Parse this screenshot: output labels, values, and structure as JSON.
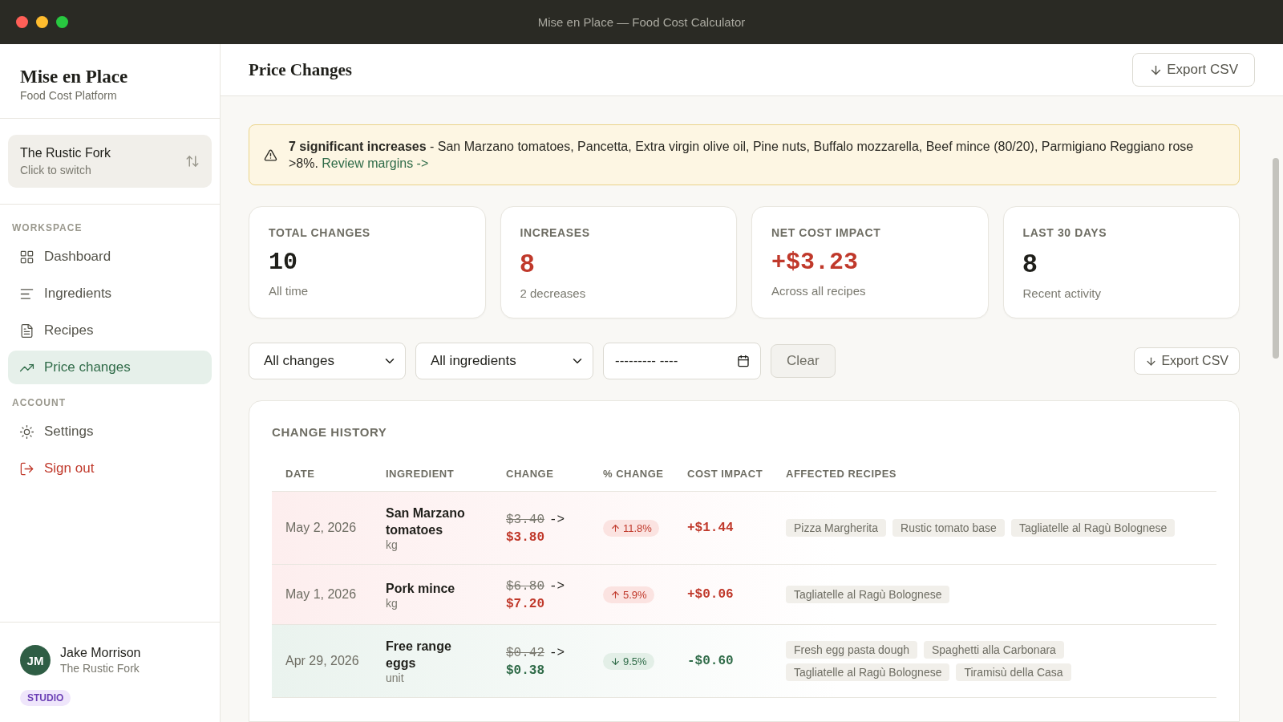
{
  "window": {
    "title": "Mise en Place — Food Cost Calculator"
  },
  "sidebar": {
    "brand": "Mise en Place",
    "tagline": "Food Cost Platform",
    "location": {
      "name": "The Rustic Fork",
      "hint": "Click to switch"
    },
    "sections": [
      {
        "heading": "WORKSPACE",
        "items": [
          {
            "label": "Dashboard",
            "selected": false,
            "danger": false
          },
          {
            "label": "Ingredients",
            "selected": false,
            "danger": false
          },
          {
            "label": "Recipes",
            "selected": false,
            "danger": false
          },
          {
            "label": "Price changes",
            "selected": true,
            "danger": false
          }
        ]
      },
      {
        "heading": "ACCOUNT",
        "items": [
          {
            "label": "Settings",
            "selected": false,
            "danger": false
          },
          {
            "label": "Sign out",
            "selected": false,
            "danger": true
          }
        ]
      }
    ],
    "user": {
      "initials": "JM",
      "name": "Jake Morrison",
      "org": "The Rustic Fork",
      "plan": "STUDIO"
    }
  },
  "header": {
    "title": "Price Changes",
    "export": "Export CSV"
  },
  "alert": {
    "text": "**7 significant increases** - San Marzano tomatoes, Pancetta, Extra virgin olive oil, Pine nuts, Buffalo mozzarella, Beef mince (80/20), Parmigiano Reggiano rose >8%.",
    "link": "Review margins ->"
  },
  "stats": [
    {
      "label": "TOTAL CHANGES",
      "value": "10",
      "note": "All time",
      "increase": false,
      "kind": "mono"
    },
    {
      "label": "INCREASES",
      "value": "8",
      "note": "2 decreases",
      "increase": true,
      "kind": "plain"
    },
    {
      "label": "NET COST IMPACT",
      "value": "+$3.23",
      "note": "Across all recipes",
      "increase": true,
      "kind": "mono"
    },
    {
      "label": "LAST 30 DAYS",
      "value": "8",
      "note": "Recent activity",
      "increase": false,
      "kind": "plain"
    }
  ],
  "filters": {
    "type": "All changes",
    "ingredient": "All ingredients",
    "date": {
      "placeholder": "--------- ----"
    },
    "clear": "Clear",
    "export": "Export CSV"
  },
  "table": {
    "title": "CHANGE HISTORY",
    "columns": [
      "DATE",
      "INGREDIENT",
      "CHANGE",
      "% CHANGE",
      "COST IMPACT",
      "AFFECTED RECIPES"
    ],
    "rows": [
      {
        "date": "May 2, 2026",
        "ingredient": "San Marzano tomatoes",
        "unit": "kg",
        "old_price": "$3.40",
        "arrow": "->",
        "new_price": "$3.80",
        "increase": true,
        "pct": "11.8%",
        "impact": "+$1.44",
        "recipes": [
          "Pizza Margherita",
          "Rustic tomato base",
          "Tagliatelle al Ragù Bolognese"
        ]
      },
      {
        "date": "May 1, 2026",
        "ingredient": "Pork mince",
        "unit": "kg",
        "old_price": "$6.80",
        "arrow": "->",
        "new_price": "$7.20",
        "increase": true,
        "pct": "5.9%",
        "impact": "+$0.06",
        "recipes": [
          "Tagliatelle al Ragù Bolognese"
        ]
      },
      {
        "date": "Apr 29, 2026",
        "ingredient": "Free range eggs",
        "unit": "unit",
        "old_price": "$0.42",
        "arrow": "->",
        "new_price": "$0.38",
        "increase": false,
        "pct": "9.5%",
        "impact": "-$0.60",
        "recipes": [
          "Fresh egg pasta dough",
          "Spaghetti alla Carbonara",
          "Tagliatelle al Ragù Bolognese",
          "Tiramisù della Casa"
        ]
      }
    ]
  }
}
